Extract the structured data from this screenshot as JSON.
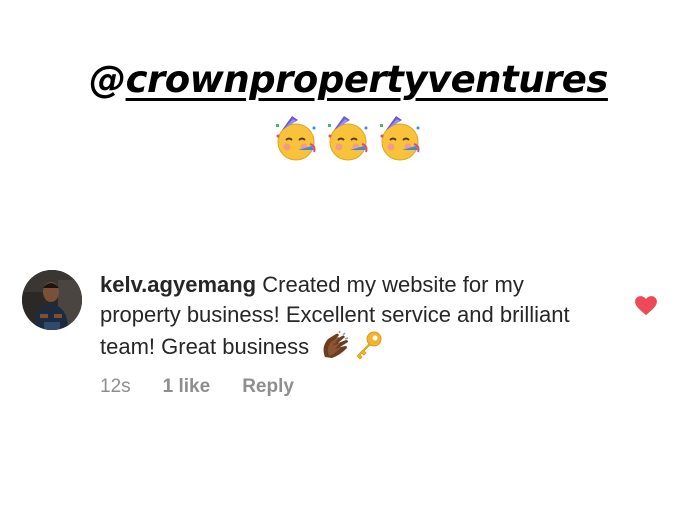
{
  "story": {
    "mention_prefix": "@",
    "mention_handle": "crownpropertyventures",
    "emojis": [
      "partying-face-icon",
      "partying-face-icon",
      "partying-face-icon"
    ]
  },
  "comment": {
    "username": "kelv.agyemang",
    "text": "Created my website for my property business! Excellent service and brilliant team! Great business",
    "trailing_emojis": [
      "clapping-hands-icon",
      "key-icon"
    ],
    "time": "12s",
    "likes": "1 like",
    "reply_label": "Reply",
    "liked": true
  },
  "colors": {
    "heart": "#ed4956",
    "meta_text": "#8e8e8e",
    "comment_text": "#262626"
  }
}
